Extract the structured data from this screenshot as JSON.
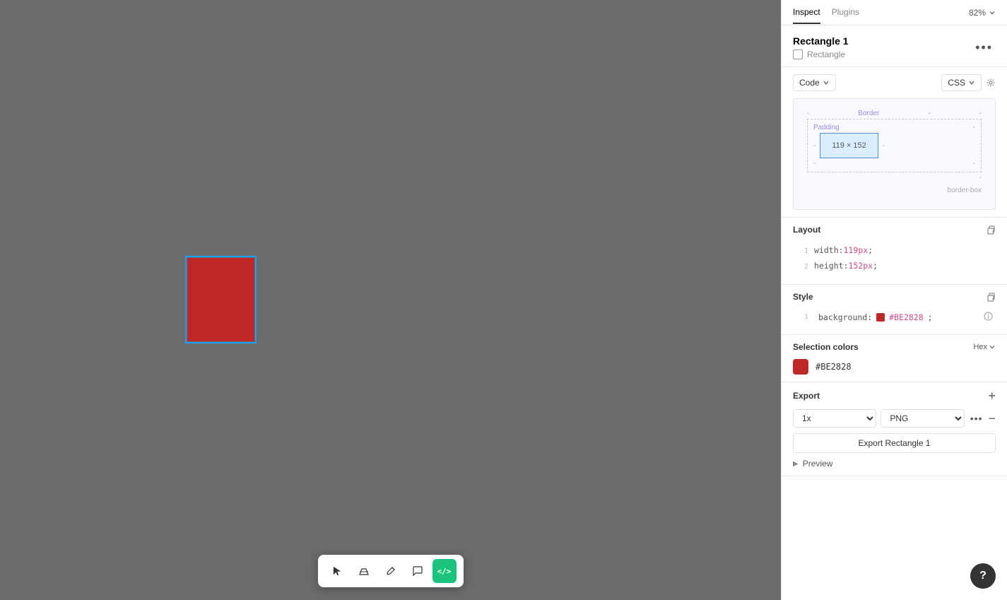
{
  "panel": {
    "tabs": {
      "inspect": "Inspect",
      "plugins": "Plugins",
      "active_tab": "inspect"
    },
    "zoom": "82%",
    "element": {
      "title": "Rectangle 1",
      "type": "Rectangle",
      "more_btn_label": "•••"
    },
    "code_section": {
      "language_dropdown": "Code",
      "format_dropdown": "CSS",
      "box_model": {
        "border_label": "Border",
        "padding_label": "Padding",
        "dimensions": "119 × 152",
        "border_box_label": "border-box"
      }
    },
    "layout": {
      "title": "Layout",
      "lines": [
        {
          "num": "1",
          "prop": "width: ",
          "val": "119px",
          "punct": ";"
        },
        {
          "num": "2",
          "prop": "height: ",
          "val": "152px",
          "punct": ";"
        }
      ]
    },
    "style": {
      "title": "Style",
      "lines": [
        {
          "num": "1",
          "prop": "background: ",
          "val": "#BE2828",
          "punct": ";"
        }
      ]
    },
    "selection_colors": {
      "title": "Selection colors",
      "format": "Hex",
      "colors": [
        {
          "hex": "#BE2828",
          "swatch_color": "#BE2828"
        }
      ]
    },
    "export": {
      "title": "Export",
      "scale": "1x",
      "format": "PNG",
      "export_btn_label": "Export Rectangle 1",
      "preview_label": "Preview"
    }
  },
  "toolbar": {
    "buttons": [
      {
        "id": "cursor",
        "icon": "▷",
        "active": false,
        "label": "cursor-tool"
      },
      {
        "id": "eraser",
        "icon": "◇",
        "active": false,
        "label": "eraser-tool"
      },
      {
        "id": "edit",
        "icon": "✎",
        "active": false,
        "label": "edit-tool"
      },
      {
        "id": "comment",
        "icon": "○",
        "active": false,
        "label": "comment-tool"
      },
      {
        "id": "code",
        "icon": "</>",
        "active": true,
        "label": "code-tool"
      }
    ]
  },
  "canvas": {
    "bg_color": "#6b6b6b",
    "rectangle": {
      "fill": "#BE2828",
      "outline": "#18a0fb"
    }
  },
  "help_btn_label": "?"
}
